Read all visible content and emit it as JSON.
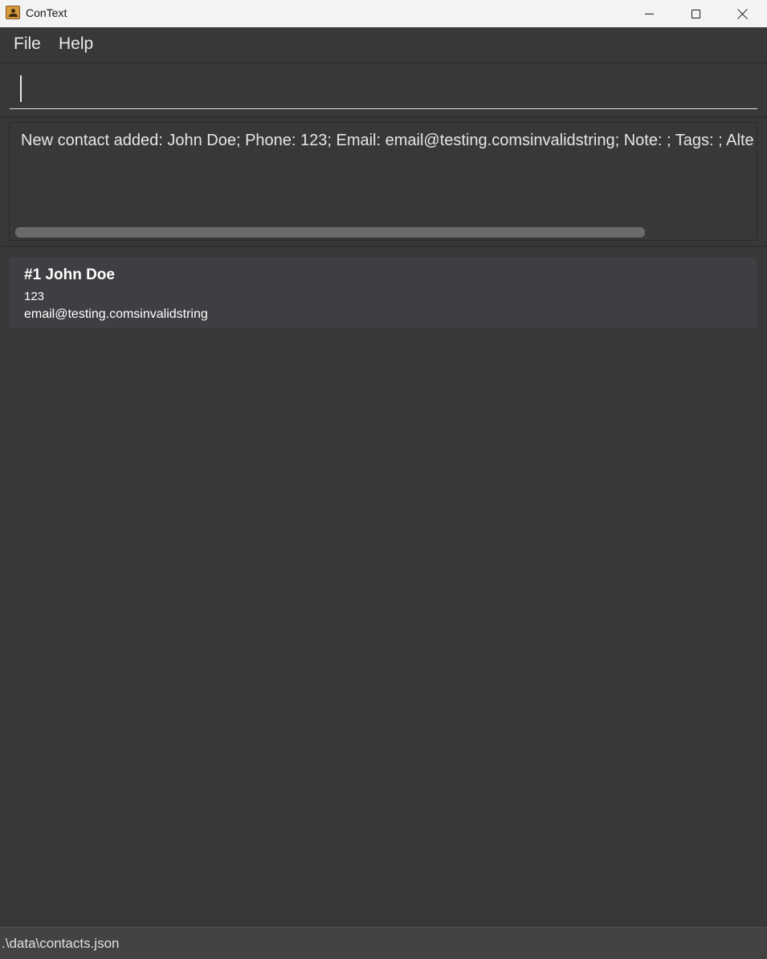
{
  "window": {
    "title": "ConText",
    "minimize_icon": "minimize-icon",
    "maximize_icon": "maximize-icon",
    "close_icon": "close-icon"
  },
  "menu": {
    "file_label": "File",
    "help_label": "Help"
  },
  "command": {
    "value": "",
    "placeholder": ""
  },
  "result": {
    "text": "New contact added: John Doe; Phone: 123; Email: email@testing.comsinvalidstring; Note: ; Tags: ; Alte"
  },
  "contacts": [
    {
      "heading": "#1 John Doe",
      "phone": "123",
      "email": "email@testing.comsinvalidstring"
    }
  ],
  "status": {
    "path": ".\\data\\contacts.json"
  },
  "colors": {
    "background": "#383838",
    "card": "#3e3f42",
    "titlebar": "#f3f3f3",
    "statusbar": "#434343"
  }
}
